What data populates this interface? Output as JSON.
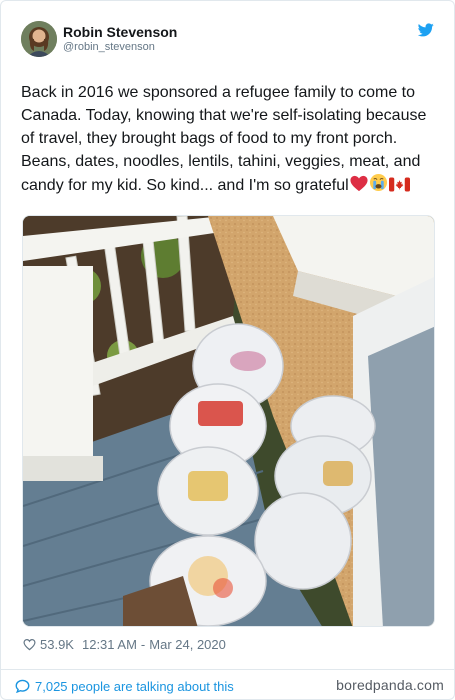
{
  "tweet": {
    "author": {
      "display_name": "Robin Stevenson",
      "handle": "@robin_stevenson"
    },
    "text": "Back in 2016 we sponsored a refugee family to come to Canada. Today, knowing that we're self-isolating because of travel, they brought bags of food to my front porch. Beans, dates, noodles, lentils, tahini, veggies, meat, and candy for my kid. So kind... and I'm so grateful",
    "emojis": [
      "red-heart-emoji",
      "crying-face-emoji",
      "canada-flag-emoji"
    ],
    "likes": "53.9K",
    "time": "12:31 AM",
    "separator": "-",
    "date": "Mar 24, 2020",
    "talking": "7,025 people are talking about this"
  },
  "watermark": "boredpanda.com",
  "colors": {
    "twitter_blue": "#1da1f2",
    "link_blue": "#1b95e0",
    "text": "#14171a",
    "muted": "#657786",
    "border": "#e1e8ed"
  }
}
